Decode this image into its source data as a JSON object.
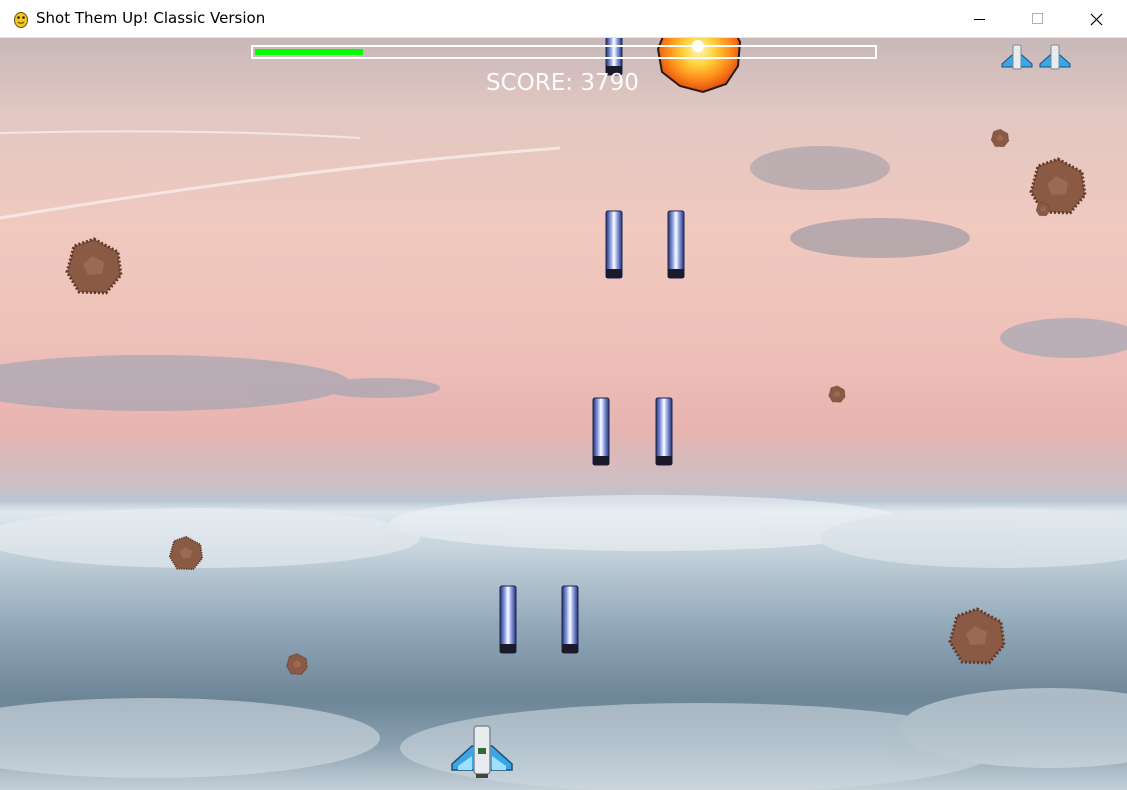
{
  "window": {
    "title": "Shot Them Up! Classic Version",
    "icon": "pygame-snake-icon",
    "controls": [
      "minimize-icon",
      "maximize-icon",
      "close-icon"
    ]
  },
  "hud": {
    "health_fraction": 0.175,
    "health_color": "#00ff00",
    "score_label": "SCORE:",
    "score_value": "3790",
    "lives_remaining": 2,
    "lives_icon": "player-ship-icon"
  },
  "scene": {
    "meteor_color": "#8a5a44",
    "laser_color": "#3c4fa8",
    "sky_colors": [
      "#f0c9bf",
      "#8aa0b0"
    ]
  }
}
